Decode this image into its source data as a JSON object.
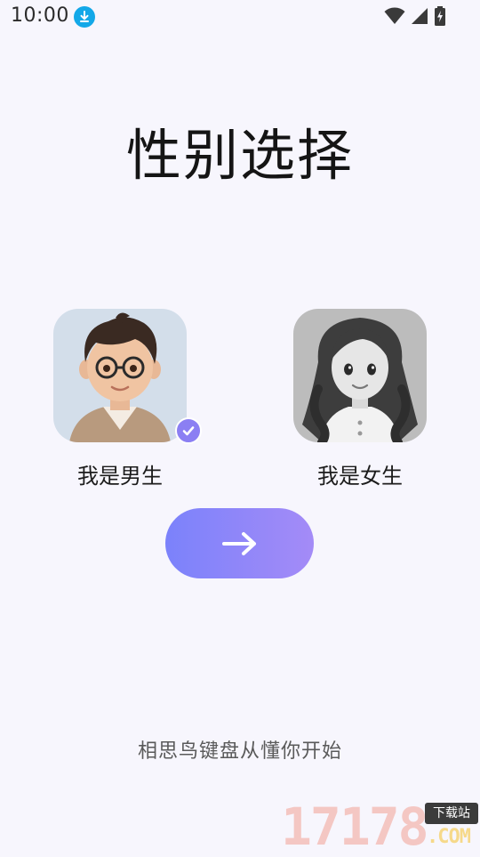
{
  "status_bar": {
    "time": "10:00",
    "icons": [
      "download-icon",
      "wifi-icon",
      "signal-icon",
      "battery-charging-icon"
    ]
  },
  "title": "性别选择",
  "options": [
    {
      "label": "我是男生",
      "selected": true,
      "avatar": "male-avatar"
    },
    {
      "label": "我是女生",
      "selected": false,
      "avatar": "female-avatar"
    }
  ],
  "next_button": {
    "icon": "arrow-right-icon"
  },
  "slogan": "相思鸟键盘从懂你开始",
  "watermark": {
    "digits": "17178",
    "tag": "下载站",
    "suffix": ".COM"
  },
  "colors": {
    "background": "#f7f6fd",
    "accent": "#8b7ff3",
    "button_gradient_start": "#7b82fb",
    "button_gradient_end": "#a48bf7"
  }
}
